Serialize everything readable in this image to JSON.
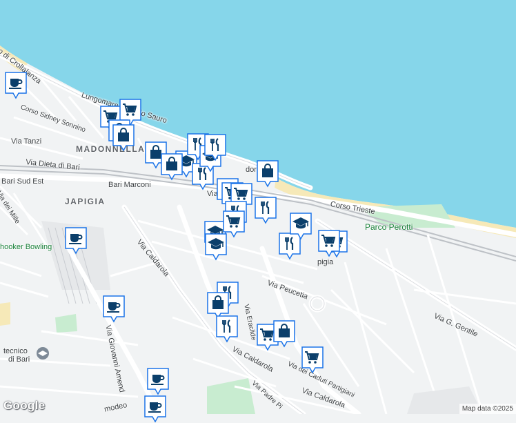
{
  "labels": {
    "crollalanza": "o di Crollalanza",
    "lungomare": "Lungomare Nazario Sauro",
    "sonnino": "Corso Sidney Sonnino",
    "tanzi": "Via Tanzi",
    "madonnella": "MADONNELLA",
    "dieta": "Via Dieta di Bari",
    "sud_est": "Bari Sud Est",
    "marconi": "Bari Marconi",
    "japigia": "JAPIGIA",
    "mille": "Via dei Mille",
    "shooker": "hooker Bowling",
    "caldarola1": "Via Caldarola",
    "peucetia": "Via Peucetia",
    "trieste": "Corso Trieste",
    "perotti": "Parco Perotti",
    "gentile": "Via G. Gentile",
    "tecnico": "tecnico",
    "dibari": "di Bari",
    "amendola": "Via Giovanni Amend",
    "caldarola2": "Via Caldarola",
    "caldarola3": "Via Caldarola",
    "caduti": "Via dei Caduti Partigiani",
    "pier": "Via Padre Pi",
    "eraclide": "Via Eraclide",
    "amodeo": "modeo",
    "pane": "doro",
    "japigia2": "pigia",
    "vial": "Via"
  },
  "markers": [
    {
      "type": "cafe",
      "icon": "coffee-icon"
    },
    {
      "type": "grocery",
      "icon": "shopping-cart-icon"
    },
    {
      "type": "grocery",
      "icon": "shopping-cart-icon"
    },
    {
      "type": "shop",
      "icon": "shopping-bag-icon"
    },
    {
      "type": "shop",
      "icon": "shopping-bag-icon"
    },
    {
      "type": "shop",
      "icon": "shopping-bag-icon"
    },
    {
      "type": "school",
      "icon": "school-icon"
    },
    {
      "type": "restaurant",
      "icon": "restaurant-icon"
    },
    {
      "type": "restaurant",
      "icon": "restaurant-icon"
    },
    {
      "type": "school",
      "icon": "school-icon"
    },
    {
      "type": "restaurant",
      "icon": "restaurant-icon"
    },
    {
      "type": "shop",
      "icon": "shopping-bag-icon"
    },
    {
      "type": "restaurant",
      "icon": "restaurant-icon"
    },
    {
      "type": "grocery",
      "icon": "shopping-cart-icon"
    },
    {
      "type": "grocery",
      "icon": "shopping-cart-icon"
    },
    {
      "type": "restaurant",
      "icon": "restaurant-icon"
    },
    {
      "type": "shop",
      "icon": "shopping-bag-icon"
    },
    {
      "type": "school",
      "icon": "school-icon"
    },
    {
      "type": "school",
      "icon": "school-icon"
    },
    {
      "type": "grocery",
      "icon": "shopping-cart-icon"
    },
    {
      "type": "restaurant",
      "icon": "restaurant-icon"
    },
    {
      "type": "restaurant",
      "icon": "restaurant-icon"
    },
    {
      "type": "grocery",
      "icon": "shopping-cart-icon"
    },
    {
      "type": "cafe",
      "icon": "coffee-icon"
    },
    {
      "type": "cafe",
      "icon": "coffee-icon"
    },
    {
      "type": "restaurant",
      "icon": "restaurant-icon"
    },
    {
      "type": "shop",
      "icon": "shopping-bag-icon"
    },
    {
      "type": "restaurant",
      "icon": "restaurant-icon"
    },
    {
      "type": "grocery",
      "icon": "shopping-cart-icon"
    },
    {
      "type": "shop",
      "icon": "shopping-bag-icon"
    },
    {
      "type": "grocery",
      "icon": "shopping-cart-icon"
    },
    {
      "type": "cafe",
      "icon": "coffee-icon"
    },
    {
      "type": "cafe",
      "icon": "coffee-icon"
    },
    {
      "type": "school",
      "icon": "school-icon"
    },
    {
      "type": "grocery",
      "icon": "shopping-cart-icon"
    }
  ],
  "attribution": {
    "logo": "Google",
    "credit": "Map data ©2025"
  },
  "colors": {
    "sea": "#86d6ea",
    "land": "#f1f3f4",
    "beach": "#f6e9b8",
    "park": "#c8ecd0",
    "marker": "#1a73e8",
    "marker_icon": "#0b3f6b"
  }
}
